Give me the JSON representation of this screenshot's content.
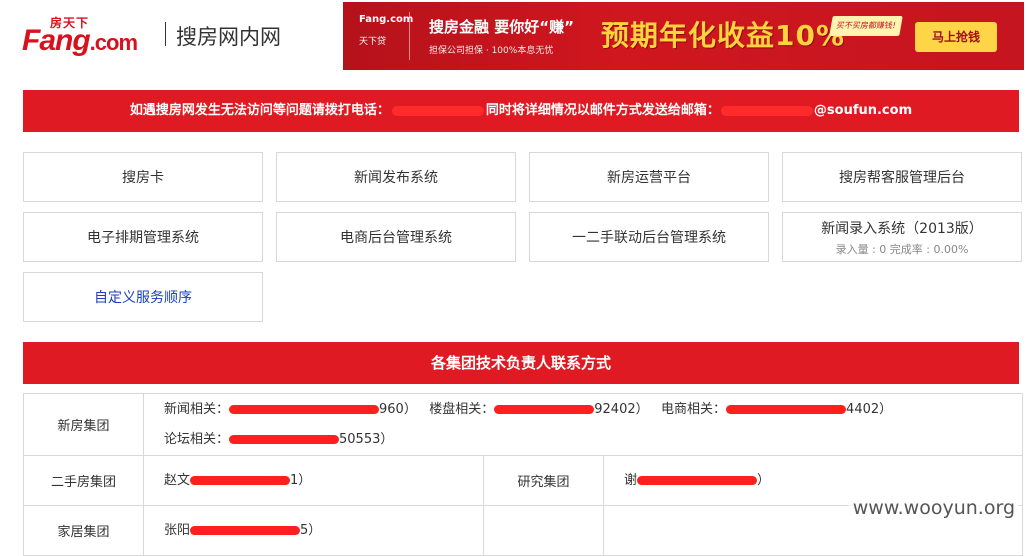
{
  "header": {
    "logo_top": "房天下",
    "logo_main": "Fang",
    "logo_dotcom": ".com",
    "logo_sub": "搜房网内网"
  },
  "banner": {
    "brand_top": "Fang.com",
    "brand_bottom": "天下贷",
    "headline": "搜房金融  要你好“赚”",
    "small": "担保公司担保 · 100%本息无忧",
    "big": "预期年化收益10%",
    "tag": "买不买房都赚钱!",
    "button": "马上抢钱"
  },
  "notice": {
    "text_a": "如遇搜房网发生无法访问等问题请拨打电话：",
    "text_b": "同时将详细情况以邮件方式发送给邮箱：",
    "text_c": "@soufun.com"
  },
  "tiles": [
    {
      "label": "搜房卡"
    },
    {
      "label": "新闻发布系统"
    },
    {
      "label": "新房运营平台"
    },
    {
      "label": "搜房帮客服管理后台"
    },
    {
      "label": "电子排期管理系统"
    },
    {
      "label": "电商后台管理系统"
    },
    {
      "label": "一二手联动后台管理系统"
    },
    {
      "label": "新闻录入系统（2013版）",
      "sub": "录入量 : 0 完成率 : 0.00%"
    },
    {
      "label": "自定义服务顺序"
    }
  ],
  "contacts": {
    "title": "各集团技术负责人联系方式",
    "rows": [
      {
        "group": "新房集团",
        "line1_a": "新闻相关：",
        "line1_a_tail": "960）",
        "line1_b": "楼盘相关：",
        "line1_b_tail": "92402）",
        "line1_c": "电商相关：",
        "line1_c_tail": "4402）",
        "line2_a": "论坛相关：",
        "line2_a_tail": "50553）"
      },
      {
        "group": "二手房集团",
        "left": "赵文",
        "left_tail": "1）",
        "right_group": "研究集团",
        "right": "谢",
        "right_tail": "）"
      },
      {
        "group": "家居集团",
        "left": "张阳",
        "left_tail": "5）"
      }
    ]
  },
  "watermark": "www.wooyun.org",
  "colors": {
    "brand_red": "#e01a23",
    "link_blue": "#1a3fc1"
  }
}
